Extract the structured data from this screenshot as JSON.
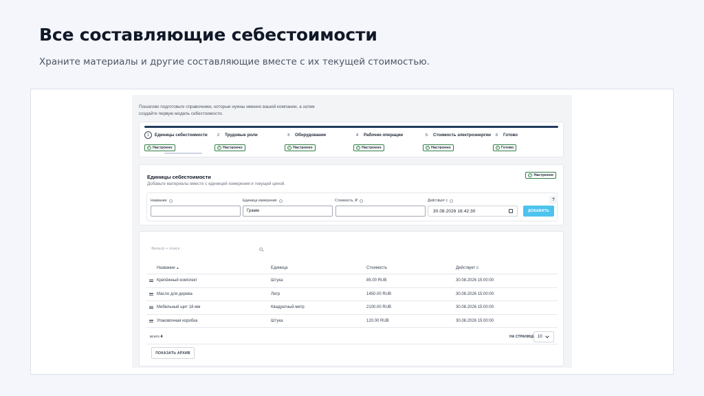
{
  "hero": {
    "title": "Все составляющие себестоимости",
    "subtitle": "Храните материалы и другие составляющие вместе с их текущей стоимостью."
  },
  "intro": "Пошагово подготовьте справочники, которые нужны именно вашей компании, а затем создайте первую модель себестоимости.",
  "steps": [
    {
      "num": "1",
      "label": "Единицы себестоимости",
      "badge": "Настроено"
    },
    {
      "num": "2",
      "label": "Трудовые роли",
      "badge": "Настроено"
    },
    {
      "num": "3",
      "label": "Оборудование",
      "badge": "Настроено"
    },
    {
      "num": "4",
      "label": "Рабочие операции",
      "badge": "Настроено"
    },
    {
      "num": "5",
      "label": "Стоимость электроэнергии",
      "badge": "Настроено"
    },
    {
      "num": "6",
      "label": "Готово",
      "badge": "Готово"
    }
  ],
  "units_section": {
    "title": "Единицы себестоимости",
    "description": "Добавьте материалы вместе с единицей измерения и текущей ценой.",
    "badge": "Настроено"
  },
  "form": {
    "name_label": "Название",
    "name_value": "",
    "unit_label": "Единица измерения",
    "unit_value": "Грамм",
    "cost_label": "Стоимость, ₽",
    "cost_value": "",
    "date_label": "Действует с",
    "date_value": "30.08.2026 16:42:30",
    "add_button": "ДОБАВИТЬ",
    "help_button": "?"
  },
  "table": {
    "filter_placeholder": "Фильтр + поиск",
    "columns": [
      "Название",
      "Единица",
      "Стоимость",
      "Действует с"
    ],
    "sort_indicator": "▲",
    "rows": [
      [
        "Крепёжный комплект",
        "Штука",
        "85.00 RUB",
        "30.08.2026 15:00:00"
      ],
      [
        "Масло для дерева",
        "Литр",
        "1450.00 RUB",
        "30.08.2026 15:00:00"
      ],
      [
        "Мебельный щит 18 мм",
        "Квадратный метр",
        "2100.00 RUB",
        "30.08.2026 15:00:00"
      ],
      [
        "Упаковочная коробка",
        "Штука",
        "120.00 RUB",
        "30.08.2026 15:00:00"
      ]
    ],
    "total_label": "всего",
    "total_value": "4",
    "per_page_label": "НА СТРАНИЦЕ",
    "per_page_value": "10",
    "archive_button": "ПОКАЗАТЬ АРХИВ"
  },
  "colors": {
    "accent": "#4dc3ee",
    "progress": "#1f3b5c",
    "success": "#2f7d46"
  }
}
